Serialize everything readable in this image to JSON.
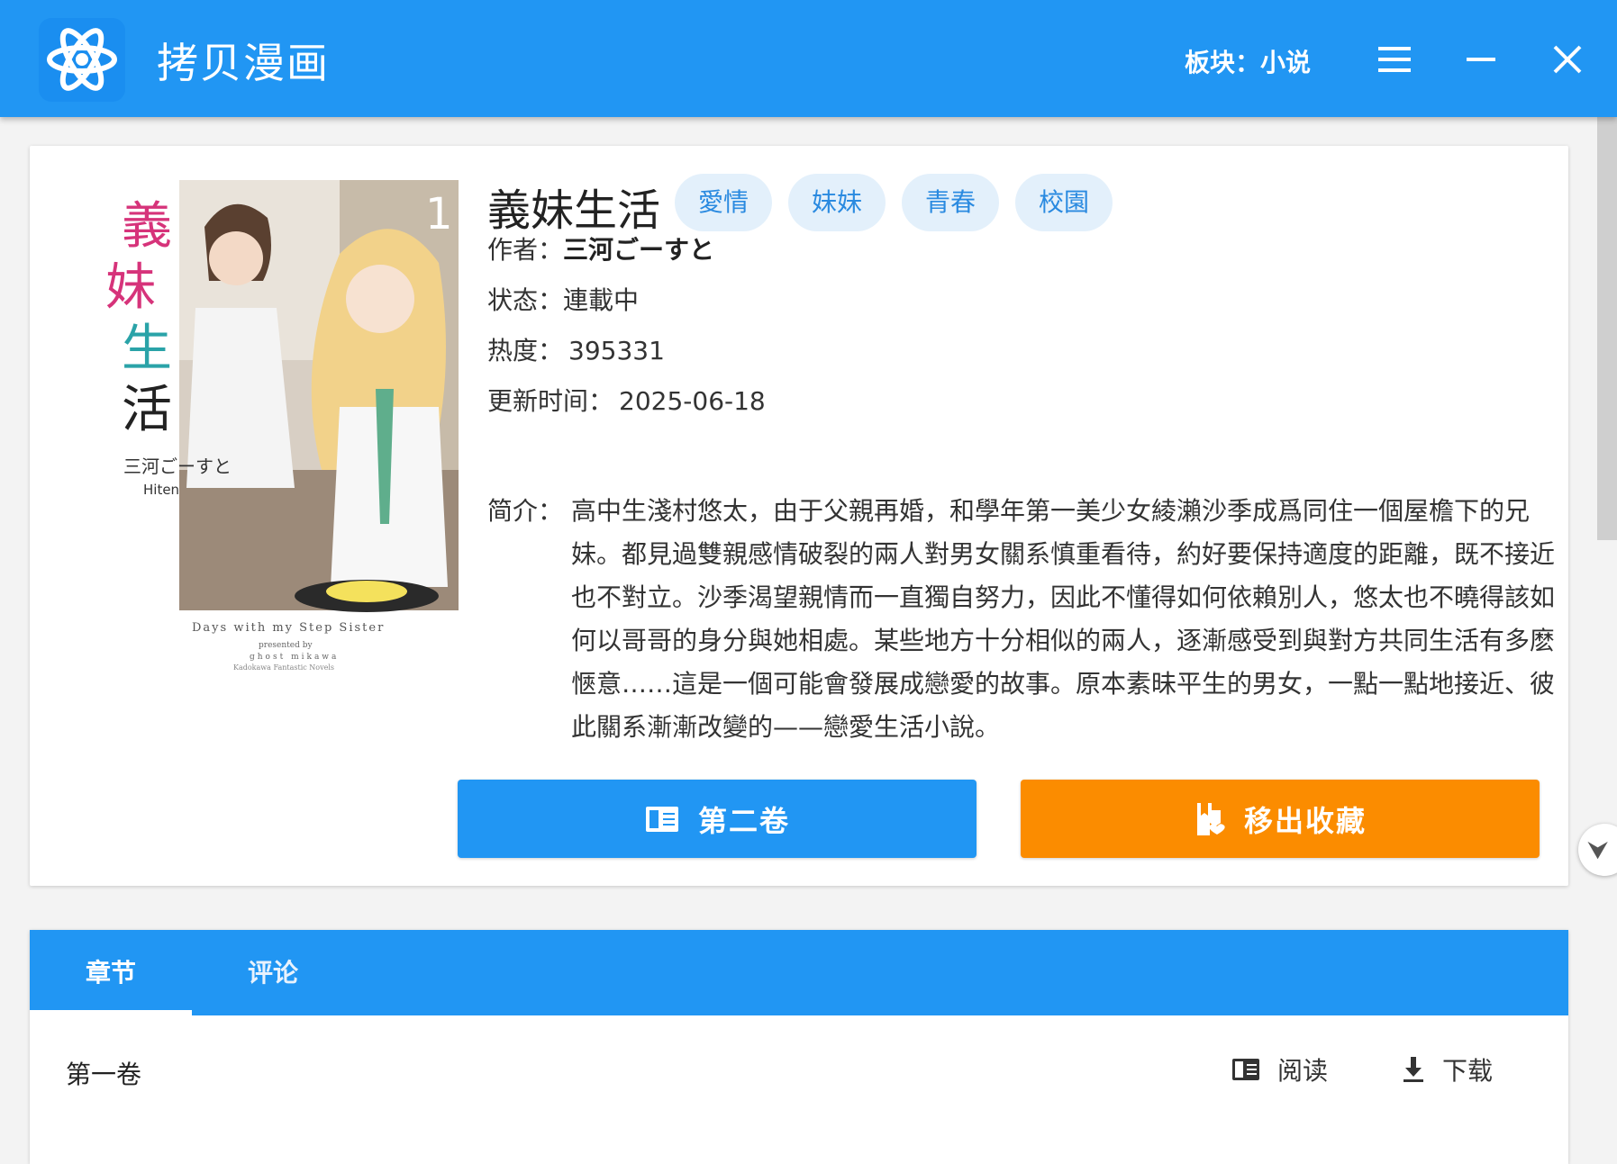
{
  "app": {
    "title": "拷贝漫画",
    "section_label": "板块：小说",
    "icons": {
      "logo": "app-logo",
      "menu": "menu-icon",
      "minimize": "minimize-icon",
      "close": "close-icon"
    }
  },
  "book": {
    "title": "義妹生活",
    "tags": [
      "愛情",
      "妹妹",
      "青春",
      "校園"
    ],
    "author_label": "作者：",
    "author": "三河ごーすと",
    "status_label": "状态：",
    "status": "連載中",
    "popularity_label": "热度：",
    "popularity": "395331",
    "updated_label": "更新时间：",
    "updated": "2025-06-18",
    "desc_label": "简介：",
    "description": "高中生淺村悠太，由于父親再婚，和學年第一美少女綾瀨沙季成爲同住一個屋檐下的兄妹。都見過雙親感情破裂的兩人對男女關系慎重看待，約好要保持適度的距離，既不接近也不對立。沙季渴望親情而一直獨自努力，因此不懂得如何依賴別人，悠太也不曉得該如何以哥哥的身分與她相處。某些地方十分相似的兩人，逐漸感受到與對方共同生活有多麽愜意……這是一個可能會發展成戀愛的故事。原本素昧平生的男女，一點一點地接近、彼此關系漸漸改變的——戀愛生活小說。",
    "cover": {
      "title_chars": [
        "義",
        "妹",
        "生",
        "活"
      ],
      "volume": "1",
      "author_line": "三河ごーすと",
      "illustrator": "Hiten",
      "english_title": "Days with my Step Sister",
      "presented": "presented by",
      "presented_name": "ghost mikawa",
      "publisher": "Kadokawa Fantastic Novels"
    }
  },
  "actions": {
    "read_label": "第二卷",
    "favorite_label": "移出收藏",
    "read_icon": "book-icon",
    "favorite_icon": "bookmark-remove-icon"
  },
  "tabs": [
    {
      "label": "章节",
      "active": true
    },
    {
      "label": "评论",
      "active": false
    }
  ],
  "chapters": [
    {
      "name": "第一卷",
      "read_label": "阅读",
      "download_label": "下载"
    }
  ],
  "colors": {
    "primary": "#2196f3",
    "accent": "#fb8c00",
    "tag_bg": "#e3f0fb",
    "tag_text": "#2a8ae0"
  }
}
